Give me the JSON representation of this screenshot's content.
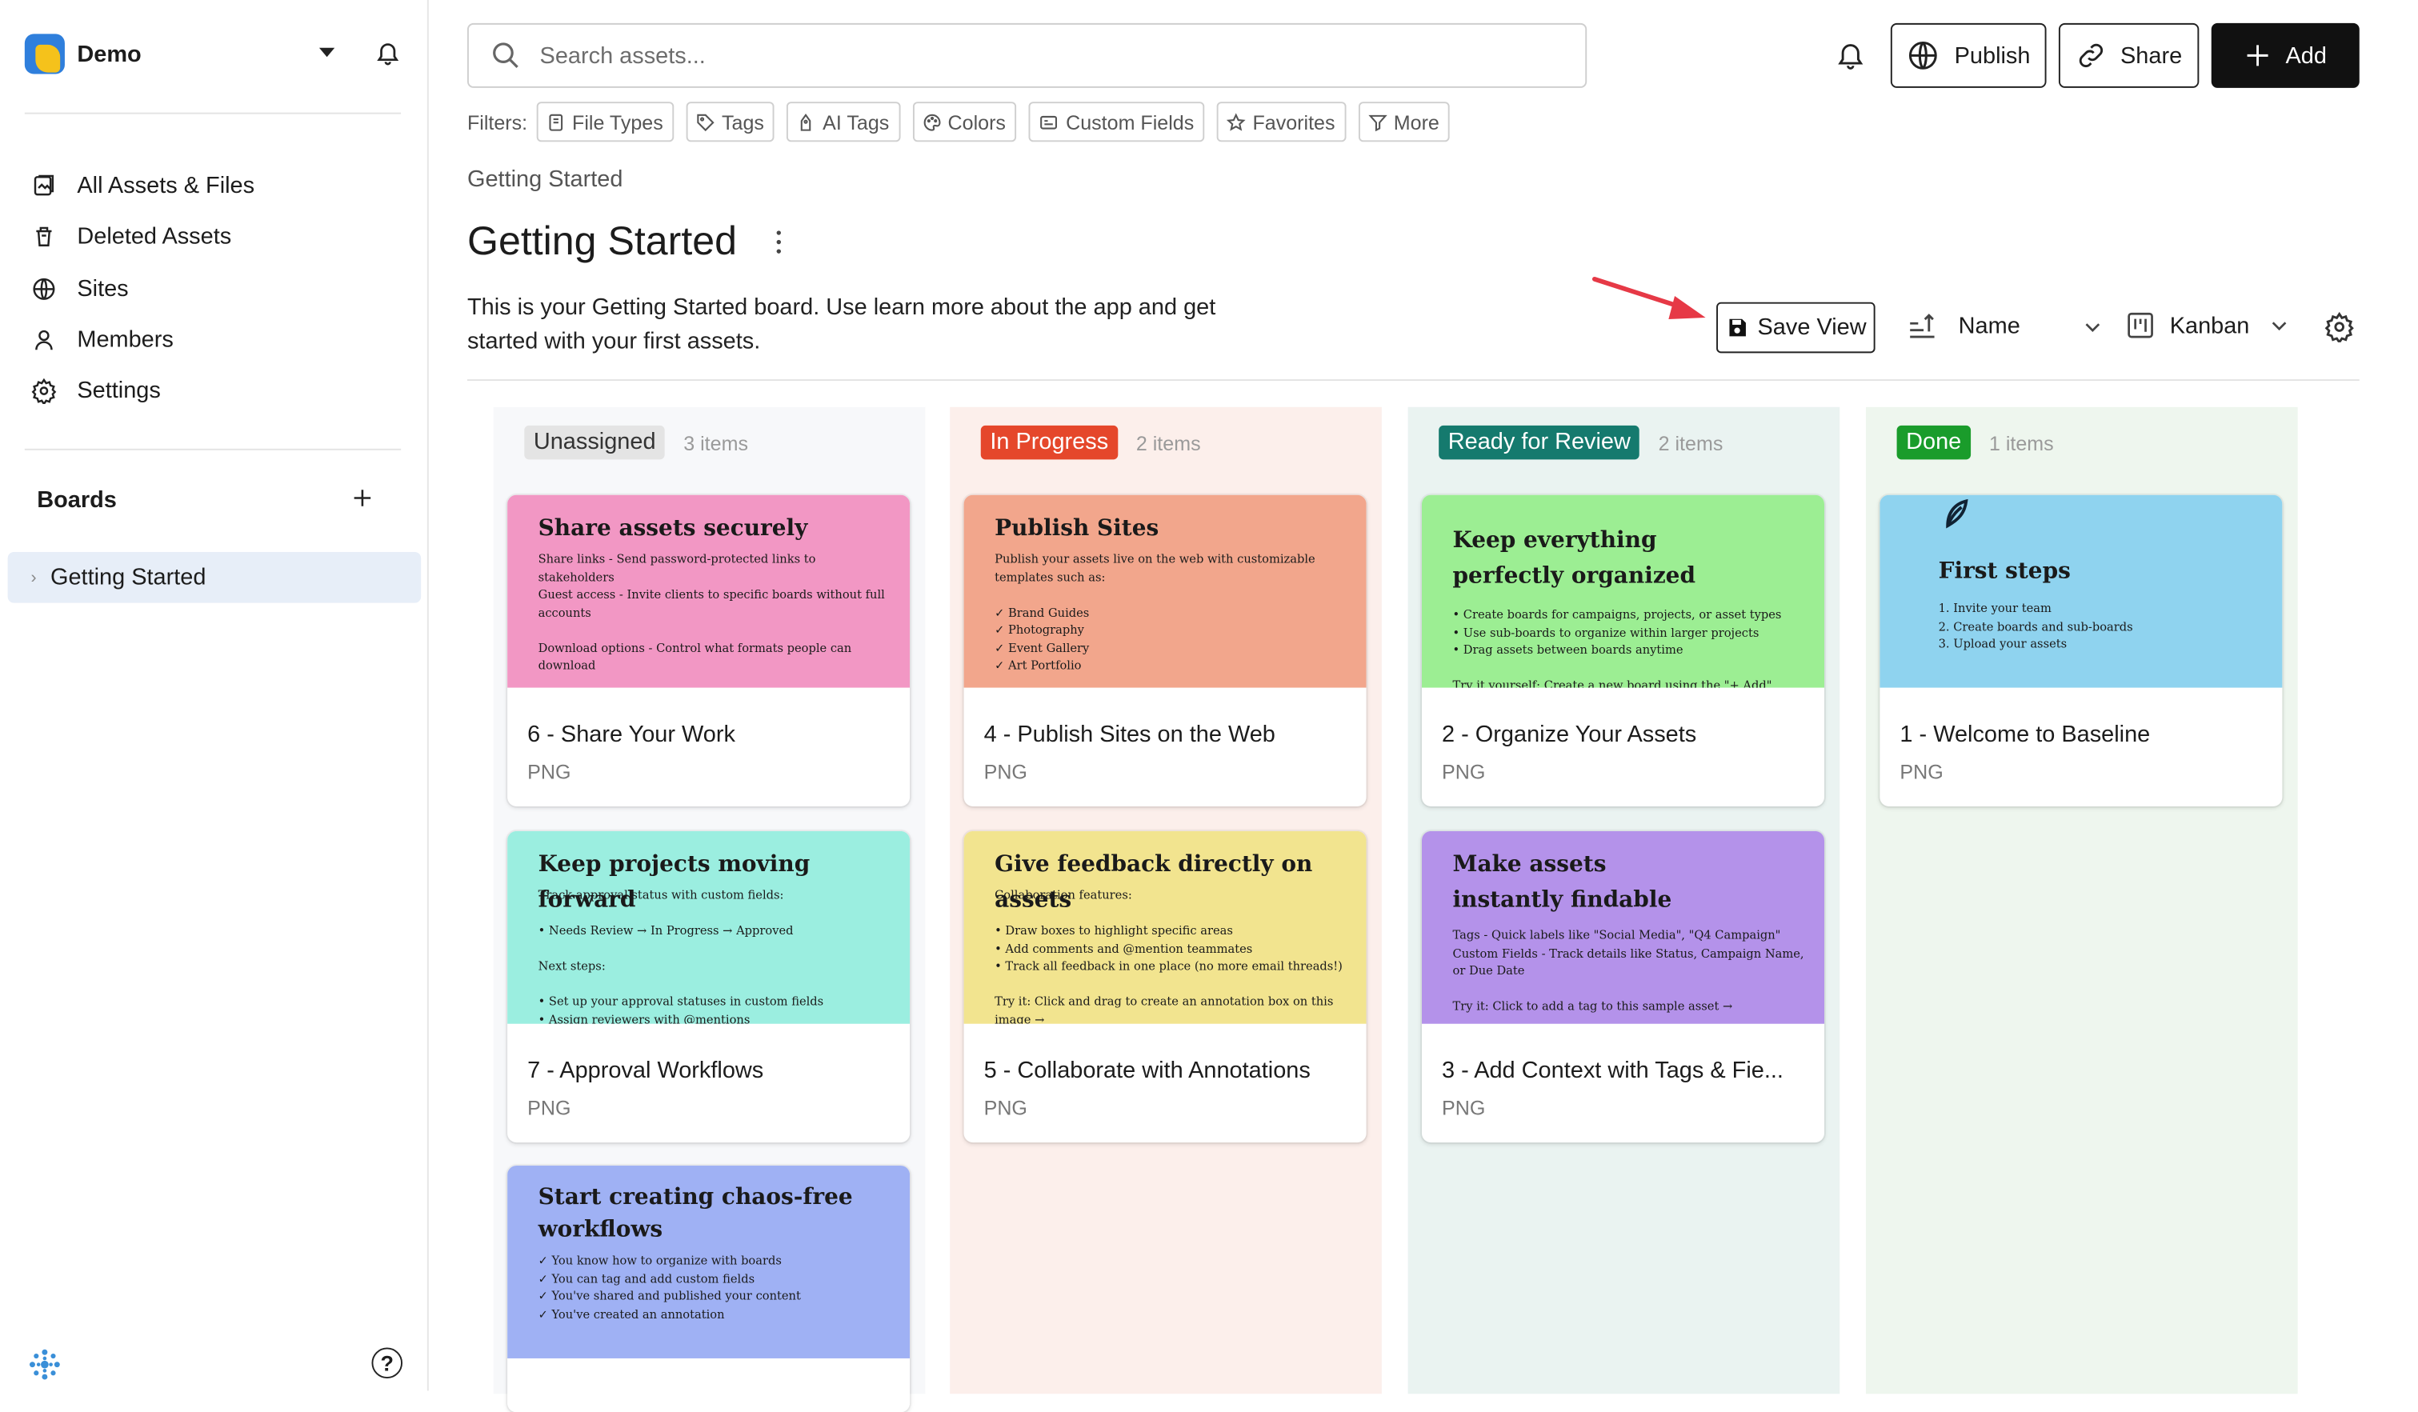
{
  "workspace": {
    "name": "Demo"
  },
  "sidebar": {
    "nav": [
      {
        "label": "All Assets & Files",
        "icon": "assets-icon"
      },
      {
        "label": "Deleted Assets",
        "icon": "trash-icon"
      },
      {
        "label": "Sites",
        "icon": "globe-icon"
      },
      {
        "label": "Members",
        "icon": "person-icon"
      },
      {
        "label": "Settings",
        "icon": "gear-icon"
      }
    ],
    "boards_heading": "Boards",
    "boards": [
      {
        "label": "Getting Started"
      }
    ],
    "help": "?"
  },
  "search": {
    "placeholder": "Search assets..."
  },
  "toolbar": {
    "publish": "Publish",
    "share": "Share",
    "add": "Add"
  },
  "filters": {
    "label": "Filters:",
    "chips": [
      "File Types",
      "Tags",
      "AI Tags",
      "Colors",
      "Custom Fields",
      "Favorites",
      "More"
    ]
  },
  "breadcrumb": "Getting Started",
  "page": {
    "title": "Getting Started",
    "description": "This is your Getting Started board. Use learn more about the app and get started with your first assets."
  },
  "view_controls": {
    "save_view": "Save View",
    "sort_by": "Name",
    "view_mode": "Kanban"
  },
  "colors": {
    "accent": "#e63946",
    "unassigned_bg": "#f7f8fa",
    "in_progress_bg": "#fcefeb",
    "review_bg": "#eaf3f1",
    "done_bg": "#eef6ee"
  },
  "columns": [
    {
      "name": "Unassigned",
      "count": "3 items",
      "cards": [
        {
          "title": "6 - Share Your Work",
          "type": "PNG",
          "thumb_title": "Share assets securely",
          "thumb_body": "Share links - Send password-protected links to stakeholders\nGuest access - Invite clients to specific boards without full accounts\n\nDownload options - Control what formats people can download"
        },
        {
          "title": "7 - Approval Workflows",
          "type": "PNG",
          "thumb_title": "Keep projects moving forward",
          "thumb_body": "Track approval status with custom fields:\n\n  • Needs Review → In Progress → Approved\n\nNext steps:\n\n  • Set up your approval statuses in custom fields\n  • Assign reviewers with @mentions"
        },
        {
          "title": "",
          "type": "",
          "thumb_title": "Start creating chaos-free workflows",
          "thumb_body": "✓ You know how to organize with boards\n✓ You can tag and add custom fields\n✓ You've shared and published your content\n✓ You've created an annotation"
        }
      ]
    },
    {
      "name": "In Progress",
      "count": "2 items",
      "cards": [
        {
          "title": "4 - Publish Sites on the Web",
          "type": "PNG",
          "thumb_title": "Publish Sites",
          "thumb_body": "Publish your assets live on the web with customizable templates such as:\n\n✓ Brand Guides\n✓ Photography\n✓ Event Gallery\n✓ Art Portfolio"
        },
        {
          "title": "5 - Collaborate with Annotations",
          "type": "PNG",
          "thumb_title": "Give feedback directly on assets",
          "thumb_body": "Collaboration features:\n\n  • Draw boxes to highlight specific areas\n  • Add comments and @mention teammates\n  • Track all feedback in one place (no more email threads!)\n\nTry it: Click and drag to create an annotation box on this image →"
        }
      ]
    },
    {
      "name": "Ready for Review",
      "count": "2 items",
      "cards": [
        {
          "title": "2 - Organize Your Assets",
          "type": "PNG",
          "thumb_title": "Keep everything perfectly organized",
          "thumb_body": "  • Create boards for campaigns, projects, or asset types\n  • Use sub-boards to organize within larger projects\n  • Drag assets between boards anytime\n\nTry it yourself: Create a new board using the \"+ Add\" button in the top"
        },
        {
          "title": "3 - Add Context with Tags & Fie...",
          "type": "PNG",
          "thumb_title": "Make assets instantly findable",
          "thumb_body": "Tags - Quick labels like \"Social Media\", \"Q4 Campaign\"\nCustom Fields - Track details like Status, Campaign Name, or Due Date\n\nTry it: Click to add a tag to this sample asset →"
        }
      ]
    },
    {
      "name": "Done",
      "count": "1 items",
      "cards": [
        {
          "title": "1 - Welcome to Baseline",
          "type": "PNG",
          "thumb_title": "First steps",
          "thumb_body": "  1. Invite your team\n  2. Create boards and sub-boards\n  3. Upload your assets"
        }
      ]
    }
  ]
}
